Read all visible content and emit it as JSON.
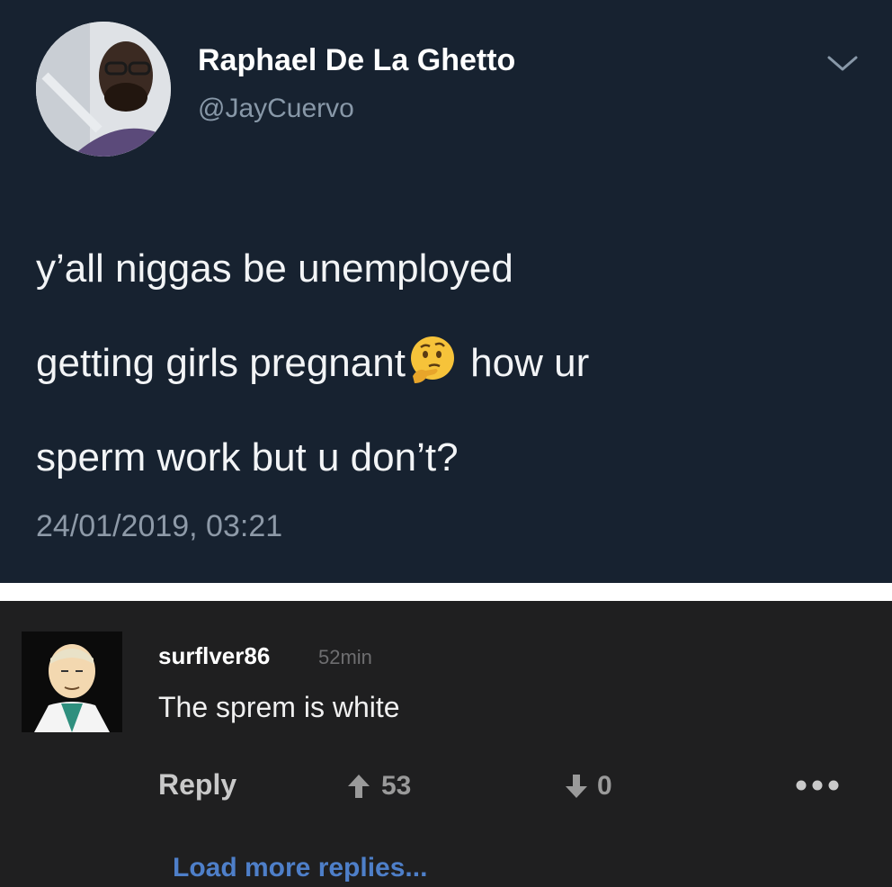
{
  "tweet": {
    "author_name": "Raphael De La Ghetto",
    "author_handle": "@JayCuervo",
    "text_line1": "y’all niggas be unemployed",
    "text_line2a": "getting girls pregnant",
    "text_line2_emoji": "thinking-face-emoji",
    "text_line2b": " how ur",
    "text_line3": "sperm work but u don’t?",
    "timestamp": "24/01/2019, 03:21",
    "icons": {
      "menu": "chevron-down-icon",
      "avatar": "profile-photo"
    },
    "colors": {
      "background": "#172230",
      "name": "#ffffff",
      "handle": "#8898a8",
      "body": "#f2f4f6"
    }
  },
  "comment": {
    "username": "surflver86",
    "time": "52min",
    "text": "The sprem is white",
    "reply_label": "Reply",
    "upvotes": "53",
    "downvotes": "0",
    "load_more_label": "Load more replies...",
    "icons": {
      "upvote": "arrow-up-icon",
      "downvote": "arrow-down-icon",
      "more": "more-dots-icon",
      "avatar": "cartoon-avatar"
    },
    "colors": {
      "background": "#1f1f20",
      "link": "#4e7fc9",
      "muted": "#9a9a9a"
    }
  }
}
